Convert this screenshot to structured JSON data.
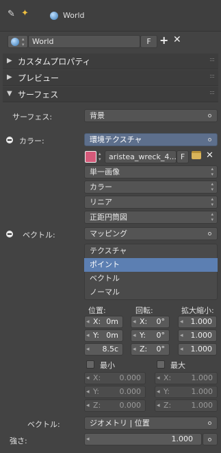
{
  "header": {
    "pin_icon": "pin-icon",
    "world_icon": "world-icon",
    "context_label": "World"
  },
  "world_selector": {
    "name": "World",
    "fake_user": "F"
  },
  "panels": {
    "custom_props": "カスタムプロパティ",
    "preview": "プレビュー",
    "surface": "サーフェス"
  },
  "surface": {
    "surface_label": "サーフェス:",
    "surface_value": "背景",
    "color_label": "カラー:",
    "color_value": "環境テクスチャ",
    "image_name": "aristea_wreck_4...",
    "image_fake": "F",
    "image_source": "単一画像",
    "color_space": "カラー",
    "interpolation": "リニア",
    "projection": "正距円筒図",
    "vector_label": "ベクトル:",
    "vector_value": "マッピング",
    "mapping_types": [
      "テクスチャ",
      "ポイント",
      "ベクトル",
      "ノーマル"
    ],
    "mapping_selected": "ポイント",
    "location_header": "位置:",
    "rotation_header": "回転:",
    "scale_header": "拡大縮小:",
    "loc": [
      {
        "k": "X:",
        "v": "0m"
      },
      {
        "k": "Y:",
        "v": "0m"
      },
      {
        "k": "",
        "v": "8.5c"
      }
    ],
    "rot": [
      {
        "k": "X:",
        "v": "0°"
      },
      {
        "k": "Y:",
        "v": "0°"
      },
      {
        "k": "Z:",
        "v": "0°"
      }
    ],
    "scale": [
      "1.000",
      "1.000",
      "1.000"
    ],
    "min_label": "最小",
    "max_label": "最大",
    "min_vals": [
      {
        "k": "X:",
        "v": "0.000"
      },
      {
        "k": "Y:",
        "v": "0.000"
      },
      {
        "k": "Z:",
        "v": "0.000"
      }
    ],
    "max_vals": [
      {
        "k": "X:",
        "v": "1.000"
      },
      {
        "k": "Y:",
        "v": "1.000"
      },
      {
        "k": "Z:",
        "v": "1.000"
      }
    ],
    "vector2_label": "ベクトル:",
    "vector2_value": "ジオメトリ | 位置",
    "strength_label": "強さ:",
    "strength_value": "1.000"
  }
}
